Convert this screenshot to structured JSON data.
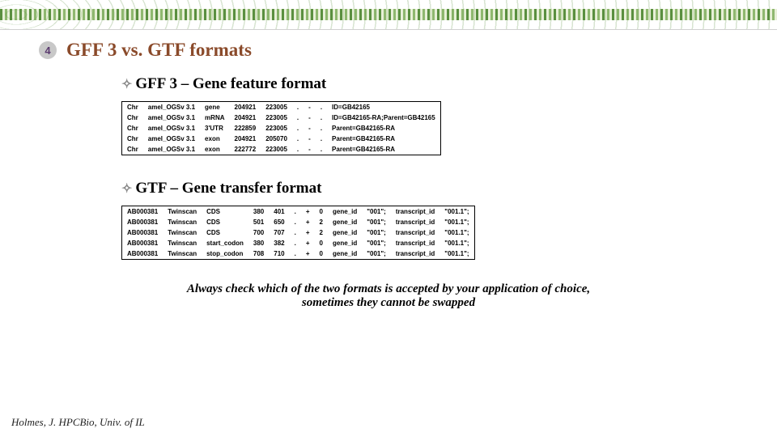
{
  "badge_number": "4",
  "title": "GFF 3 vs. GTF formats",
  "section1_label": "GFF 3 – Gene feature format",
  "section2_label": "GTF – Gene transfer format",
  "gff3_rows": [
    [
      "Chr",
      "amel_OGSv 3.1",
      "gene",
      "204921",
      "223005",
      ".",
      "-",
      ".",
      "ID=GB42165"
    ],
    [
      "Chr",
      "amel_OGSv 3.1",
      "mRNA",
      "204921",
      "223005",
      ".",
      "-",
      ".",
      "   ID=GB42165-RA;Parent=GB42165"
    ],
    [
      "Chr",
      "amel_OGSv 3.1",
      "3'UTR",
      "222859",
      "223005",
      ".",
      "-",
      ".",
      "   Parent=GB42165-RA"
    ],
    [
      "Chr",
      "amel_OGSv 3.1",
      "exon",
      "204921",
      "205070",
      ".",
      "-",
      ".",
      "Parent=GB42165-RA"
    ],
    [
      "Chr",
      "amel_OGSv 3.1",
      "exon",
      "222772",
      "223005",
      ".",
      "-",
      ".",
      "Parent=GB42165-RA"
    ]
  ],
  "gtf_rows": [
    [
      "AB000381",
      "Twinscan",
      "CDS",
      "380",
      "401",
      ".",
      "+",
      "0",
      "gene_id",
      "\"001\";",
      "transcript_id",
      "\"001.1\";"
    ],
    [
      "AB000381",
      "Twinscan",
      "CDS",
      "501",
      "650",
      ".",
      "+",
      "2",
      "gene_id",
      "\"001\";",
      "transcript_id",
      "\"001.1\";"
    ],
    [
      "AB000381",
      "Twinscan",
      "CDS",
      "700",
      "707",
      ".",
      "+",
      "2",
      "gene_id",
      "\"001\";",
      "transcript_id",
      "\"001.1\";"
    ],
    [
      "AB000381",
      "Twinscan",
      "start_codon",
      "380",
      "382",
      ".",
      "+",
      "0",
      "gene_id",
      "\"001\";",
      "transcript_id",
      "\"001.1\";"
    ],
    [
      "AB000381",
      "Twinscan",
      "stop_codon",
      "708",
      "710",
      ".",
      "+",
      "0",
      "gene_id",
      "\"001\";",
      "transcript_id",
      "\"001.1\";"
    ]
  ],
  "footer_line1": "Always check which of the two formats is accepted by your application of choice,",
  "footer_line2": "sometimes they cannot be swapped",
  "credit": "Holmes, J. HPCBio, Univ. of IL"
}
